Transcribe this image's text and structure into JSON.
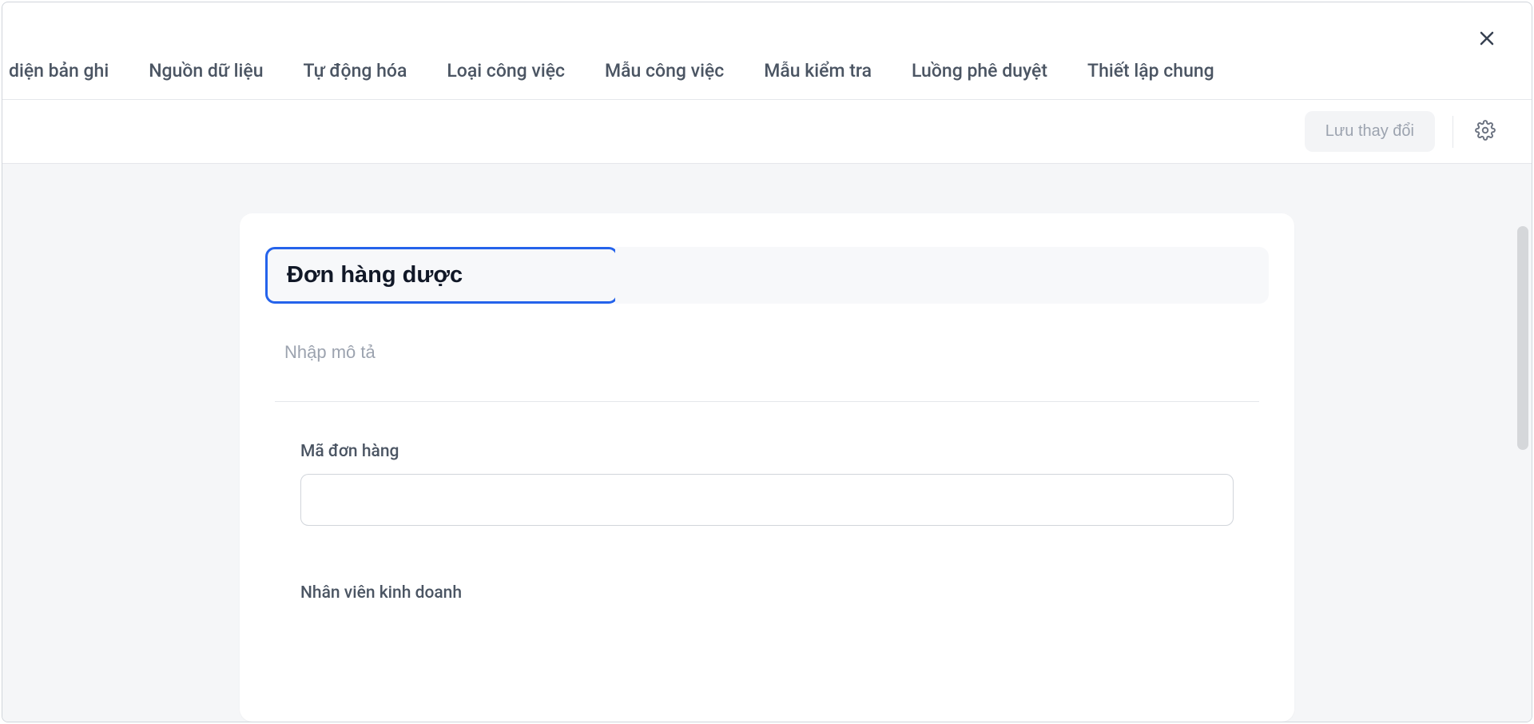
{
  "tabs": [
    {
      "label": "diện bản ghi"
    },
    {
      "label": "Nguồn dữ liệu"
    },
    {
      "label": "Tự động hóa"
    },
    {
      "label": "Loại công việc"
    },
    {
      "label": "Mẫu công việc"
    },
    {
      "label": "Mẫu kiểm tra"
    },
    {
      "label": "Luồng phê duyệt"
    },
    {
      "label": "Thiết lập chung"
    }
  ],
  "toolbar": {
    "save_label": "Lưu thay đổi"
  },
  "form": {
    "title_value": "Đơn hàng dược",
    "description_placeholder": "Nhập mô tả",
    "fields": [
      {
        "label": "Mã đơn hàng"
      },
      {
        "label": "Nhân viên kinh doanh"
      }
    ]
  }
}
